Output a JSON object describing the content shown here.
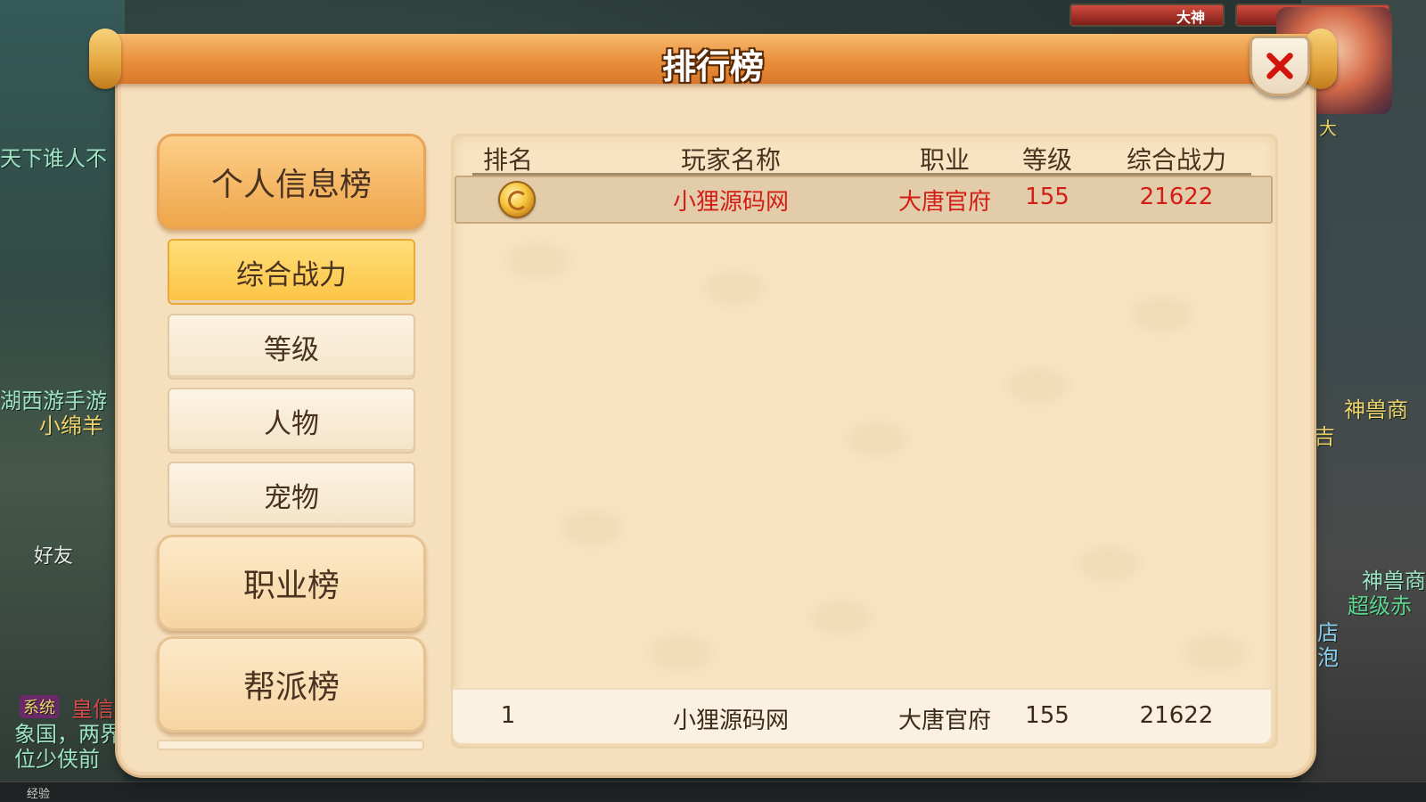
{
  "background": {
    "left_texts": [
      "天下谁人不",
      "湖西游手游",
      "小绵羊",
      "好友",
      "系统",
      "皇信",
      "象国，两界",
      "位少侠前"
    ],
    "right_texts": [
      "神兽商",
      "吉",
      "神兽商",
      "超级赤",
      "店",
      "泡",
      "大"
    ],
    "top_bars": [
      "大神",
      "大神"
    ],
    "exp_label": "经验"
  },
  "panel": {
    "title": "排行榜"
  },
  "menu": {
    "personal": "个人信息榜",
    "sub_items": [
      "综合战力",
      "等级",
      "人物",
      "宠物"
    ],
    "profession": "职业榜",
    "guild": "帮派榜"
  },
  "table": {
    "headers": [
      "排名",
      "玩家名称",
      "职业",
      "等级",
      "综合战力"
    ],
    "rows": [
      {
        "rank": "1",
        "name": "小狸源码网",
        "profession": "大唐官府",
        "level": "155",
        "power": "21622"
      }
    ],
    "my_row": {
      "rank": "1",
      "name": "小狸源码网",
      "profession": "大唐官府",
      "level": "155",
      "power": "21622"
    }
  },
  "colors": {
    "title_bar": "#e98f3b",
    "highlight_text": "#d21e16",
    "active_sub": "#fbc443",
    "panel_bg": "#f6dfbd"
  }
}
